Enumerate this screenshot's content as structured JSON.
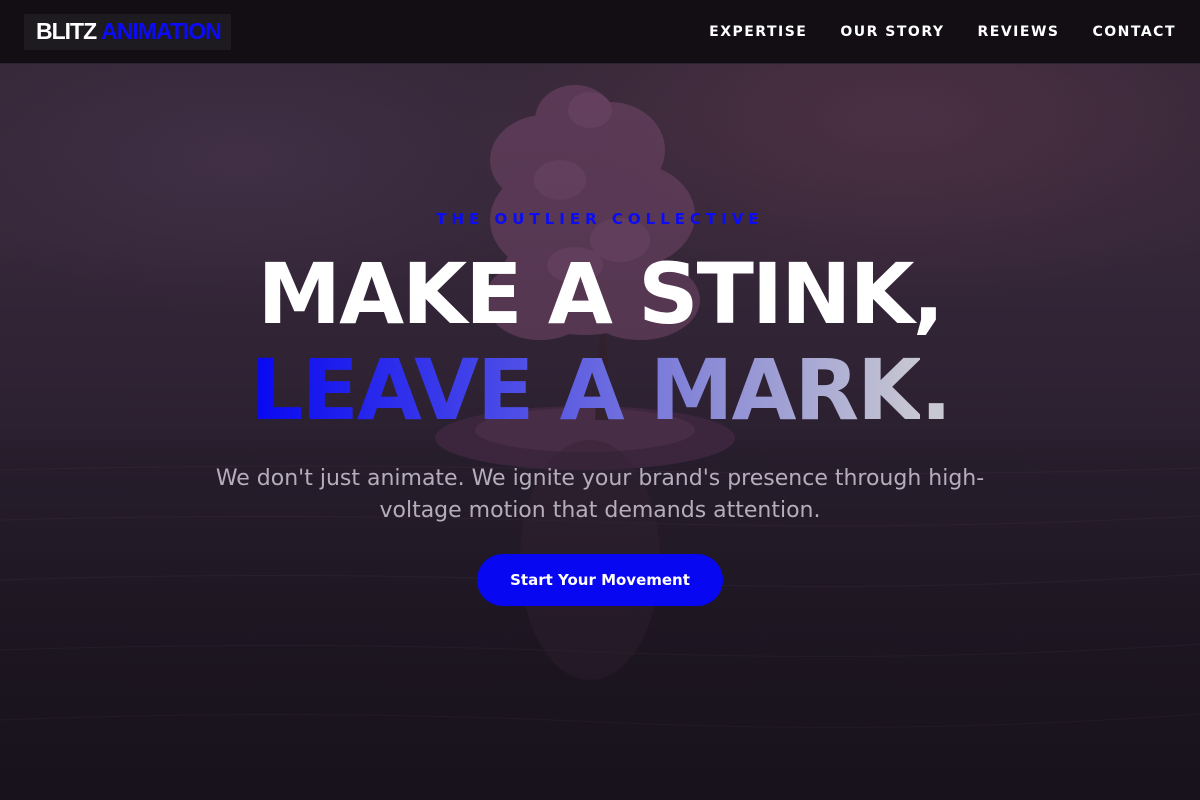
{
  "brand": {
    "name_primary": "BLITZ",
    "name_secondary": "ANIMATION",
    "accent_color": "#0707f2"
  },
  "nav": {
    "items": [
      {
        "label": "EXPERTISE"
      },
      {
        "label": "OUR STORY"
      },
      {
        "label": "REVIEWS"
      },
      {
        "label": "CONTACT"
      }
    ]
  },
  "hero": {
    "eyebrow": "THE OUTLIER COLLECTIVE",
    "headline_line1": "MAKE A STINK,",
    "headline_line2": "LEAVE A MARK",
    "headline_line2_end": ".",
    "subtitle": "We don't just animate. We ignite your brand's presence through high-voltage motion that demands attention.",
    "cta_label": "Start Your Movement"
  }
}
